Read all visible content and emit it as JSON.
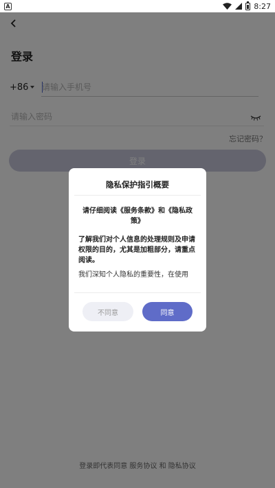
{
  "status_bar": {
    "app_badge": "A",
    "time": "8:27",
    "icons": [
      "wifi-icon",
      "signal-icon",
      "battery-icon"
    ]
  },
  "page": {
    "back_icon": "chevron-left-icon",
    "title": "登录"
  },
  "form": {
    "country_code": "+86",
    "phone_placeholder": "请输入手机号",
    "password_placeholder": "请输入密码",
    "eye_icon": "eye-closed-icon",
    "forgot_label": "忘记密码？",
    "login_label": "登录"
  },
  "footer": {
    "text": "登录即代表同意 服务协议 和 隐私协议"
  },
  "dialog": {
    "title": "隐私保护指引概要",
    "paragraph1": "请仔细阅读《服务条款》和《隐私政策》",
    "paragraph2": "了解我们对个人信息的处理规则及申请权限的目的，尤其是加粗部分，请重点阅读。",
    "paragraph3": "我们深知个人隐私的重要性，在使用",
    "disagree_label": "不同意",
    "agree_label": "同意"
  },
  "colors": {
    "accent": "#5f6cc8",
    "login_disabled": "#c8c9dd",
    "overlay": "rgba(0,0,0,0.5)"
  }
}
